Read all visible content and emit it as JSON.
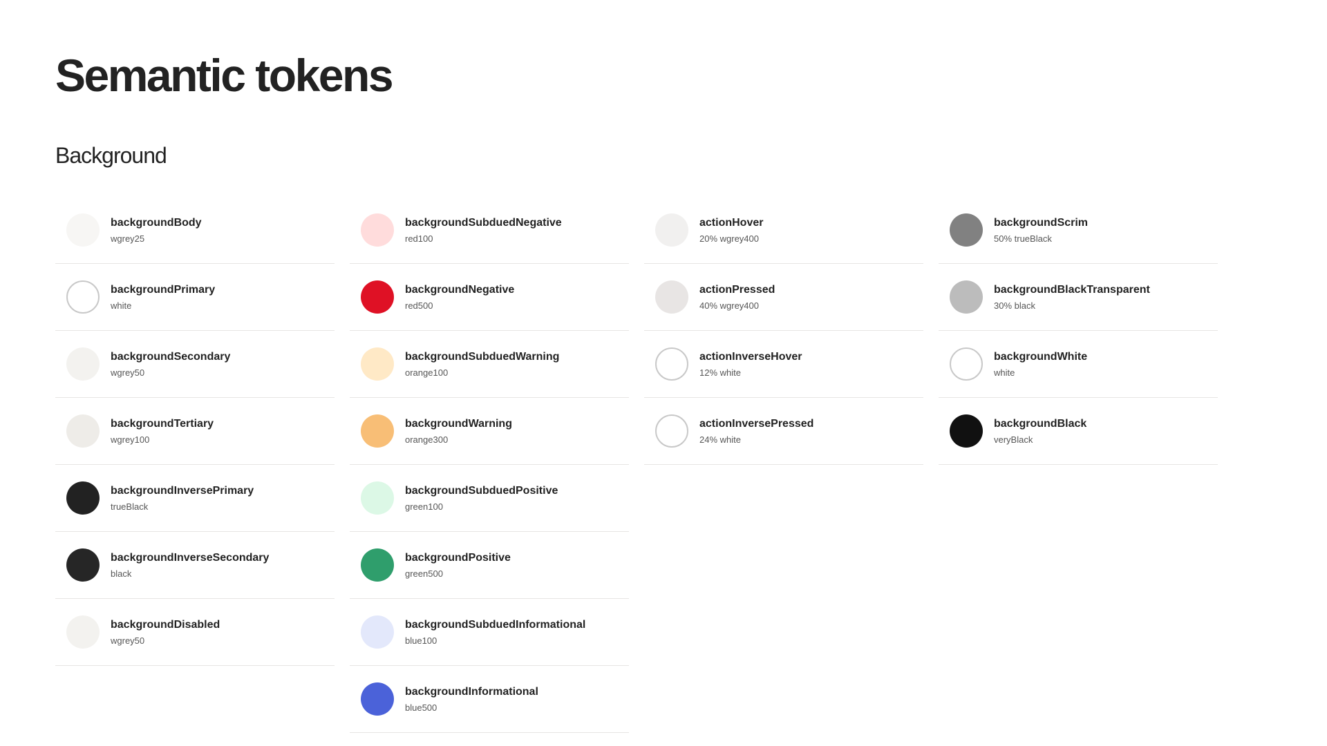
{
  "page": {
    "title": "Semantic tokens",
    "section_title": "Background"
  },
  "columns": [
    {
      "tokens": [
        {
          "name": "backgroundBody",
          "value": "wgrey25",
          "color": "#f7f6f4",
          "outlined": false
        },
        {
          "name": "backgroundPrimary",
          "value": "white",
          "color": "#ffffff",
          "outlined": true
        },
        {
          "name": "backgroundSecondary",
          "value": "wgrey50",
          "color": "#f3f2ef",
          "outlined": false
        },
        {
          "name": "backgroundTertiary",
          "value": "wgrey100",
          "color": "#eeece8",
          "outlined": false
        },
        {
          "name": "backgroundInversePrimary",
          "value": "trueBlack",
          "color": "#222222",
          "outlined": false
        },
        {
          "name": "backgroundInverseSecondary",
          "value": "black",
          "color": "#262626",
          "outlined": false
        },
        {
          "name": "backgroundDisabled",
          "value": "wgrey50",
          "color": "#f3f2ef",
          "outlined": false
        }
      ]
    },
    {
      "tokens": [
        {
          "name": "backgroundSubduedNegative",
          "value": "red100",
          "color": "#ffdcdc",
          "outlined": false
        },
        {
          "name": "backgroundNegative",
          "value": "red500",
          "color": "#df1125",
          "outlined": false
        },
        {
          "name": "backgroundSubduedWarning",
          "value": "orange100",
          "color": "#ffe9c6",
          "outlined": false
        },
        {
          "name": "backgroundWarning",
          "value": "orange300",
          "color": "#f8be76",
          "outlined": false
        },
        {
          "name": "backgroundSubduedPositive",
          "value": "green100",
          "color": "#dcf8e6",
          "outlined": false
        },
        {
          "name": "backgroundPositive",
          "value": "green500",
          "color": "#2f9e6c",
          "outlined": false
        },
        {
          "name": "backgroundSubduedInformational",
          "value": "blue100",
          "color": "#e3e8fb",
          "outlined": false
        },
        {
          "name": "backgroundInformational",
          "value": "blue500",
          "color": "#4b62d9",
          "outlined": false
        }
      ]
    },
    {
      "tokens": [
        {
          "name": "actionHover",
          "value": "20% wgrey400",
          "color": "#f1f0ef",
          "outlined": false
        },
        {
          "name": "actionPressed",
          "value": "40% wgrey400",
          "color": "#e8e5e4",
          "outlined": false
        },
        {
          "name": "actionInverseHover",
          "value": "12% white",
          "color": "#ffffff",
          "outlined": true
        },
        {
          "name": "actionInversePressed",
          "value": "24% white",
          "color": "#ffffff",
          "outlined": true
        }
      ]
    },
    {
      "tokens": [
        {
          "name": "backgroundScrim",
          "value": "50% trueBlack",
          "color": "#818181",
          "outlined": false
        },
        {
          "name": "backgroundBlackTransparent",
          "value": "30% black",
          "color": "#bcbcbc",
          "outlined": false
        },
        {
          "name": "backgroundWhite",
          "value": "white",
          "color": "#ffffff",
          "outlined": true
        },
        {
          "name": "backgroundBlack",
          "value": "veryBlack",
          "color": "#111111",
          "outlined": false
        }
      ]
    }
  ]
}
